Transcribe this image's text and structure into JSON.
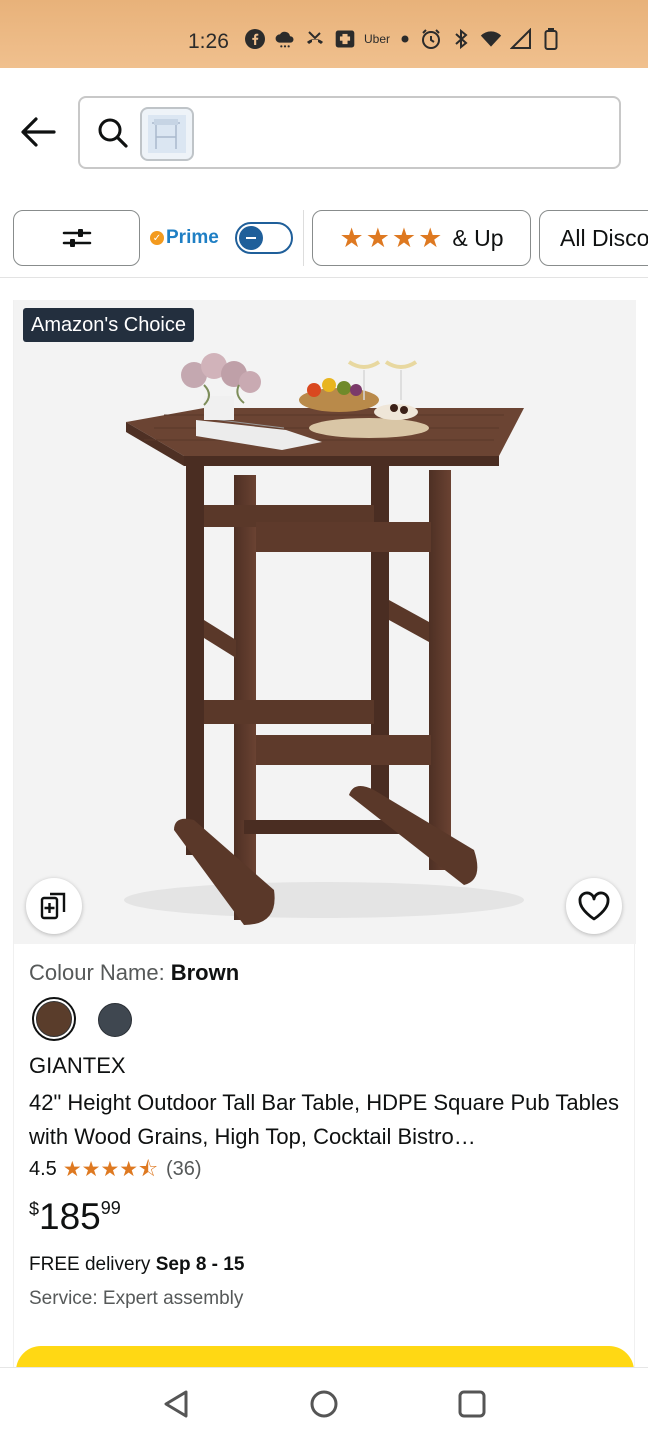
{
  "status_bar": {
    "time": "1:26",
    "icons": [
      "facebook-icon",
      "cloud-icon",
      "missed-call-icon",
      "calendar-icon",
      "uber-icon",
      "dot-icon",
      "alarm-icon",
      "bluetooth-icon",
      "wifi-icon",
      "signal-icon",
      "battery-icon"
    ],
    "uber_label": "Uber",
    "background": "#f0c08e"
  },
  "search": {
    "back_icon": "arrow-left-icon",
    "search_icon": "search-icon",
    "image_thumbnail": "search-image-thumbnail"
  },
  "filters": {
    "filter_icon": "sliders-icon",
    "prime_label": "Prime",
    "prime_toggle_on": false,
    "stars_label": "& Up",
    "stars_count": 4,
    "discount_label": "All Disco"
  },
  "product": {
    "badge": "Amazon's Choice",
    "colour_label": "Colour Name:",
    "colour_value": "Brown",
    "swatches": [
      {
        "name": "Brown",
        "color": "#5a3d2b",
        "selected": true
      },
      {
        "name": "Dark grey",
        "color": "#3f4750",
        "selected": false
      }
    ],
    "brand": "GIANTEX",
    "title": "42\" Height Outdoor Tall Bar Table, HDPE Square Pub Tables with Wood Grains, High Top, Cocktail Bistro…",
    "rating": "4.5",
    "rating_stars": 4.5,
    "review_count": "(36)",
    "price_currency": "$",
    "price_whole": "185",
    "price_fraction": "99",
    "delivery_prefix": "FREE delivery",
    "delivery_dates": "Sep 8 - 15",
    "service": "Service: Expert assembly",
    "add_to_cart_color": "#ffd814"
  },
  "nav": {
    "back": "nav-back-icon",
    "home": "nav-home-icon",
    "recents": "nav-recents-icon"
  },
  "colors": {
    "star": "#de7921",
    "prime_blue": "#1f7fc4",
    "badge_bg": "#232f3e"
  }
}
